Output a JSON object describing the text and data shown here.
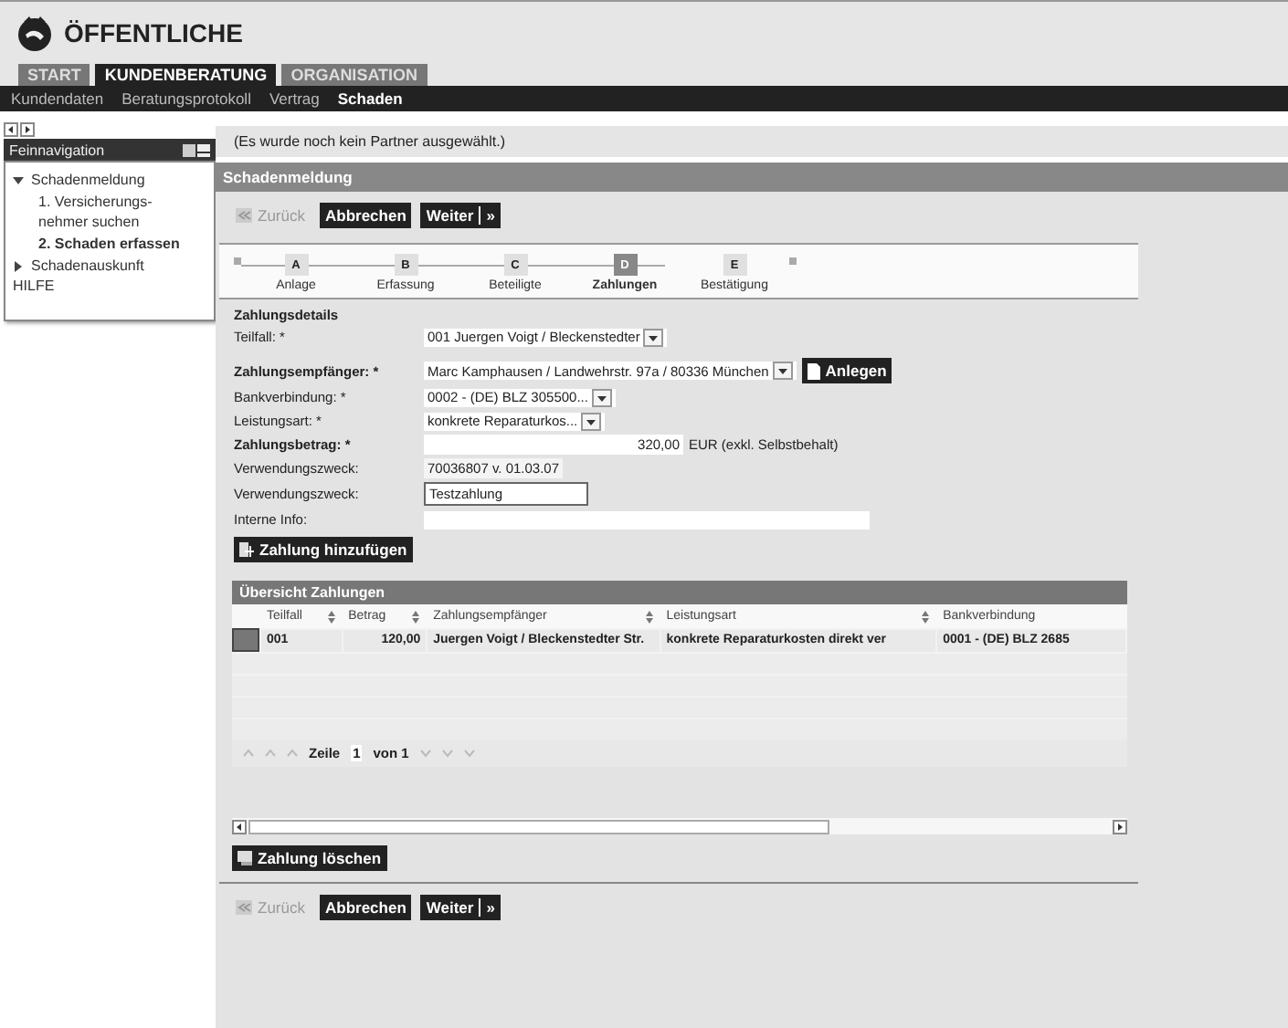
{
  "logo": {
    "name": "ÖFFENTLICHE"
  },
  "tabs": [
    {
      "label": "START",
      "selected": false
    },
    {
      "label": "KUNDENBERATUNG",
      "selected": true
    },
    {
      "label": "ORGANISATION",
      "selected": false
    }
  ],
  "subnav": [
    {
      "label": "Kundendaten",
      "selected": false
    },
    {
      "label": "Beratungsprotokoll",
      "selected": false
    },
    {
      "label": "Vertrag",
      "selected": false
    },
    {
      "label": "Schaden",
      "selected": true
    }
  ],
  "sidebar": {
    "title": "Feinnavigation",
    "items": [
      {
        "label": "Schadenmeldung",
        "kind": "group",
        "expanded": true,
        "children": [
          {
            "label": "1. Versicherungs-nehmer suchen",
            "selected": false
          },
          {
            "label": "2. Schaden erfassen",
            "selected": true
          }
        ]
      },
      {
        "label": "Schadenauskunft",
        "kind": "group",
        "expanded": false
      },
      {
        "label": "HILFE",
        "kind": "link"
      }
    ]
  },
  "message": "(Es wurde noch kein Partner ausgewählt.)",
  "panel_title": "Schadenmeldung",
  "top_buttons": [
    {
      "label": "Zurück",
      "kind": "back",
      "disabled": true
    },
    {
      "label": "Abbrechen",
      "kind": "plain",
      "disabled": false
    },
    {
      "label": "Weiter",
      "kind": "next",
      "disabled": false,
      "suffix": "»"
    }
  ],
  "steps": [
    {
      "letter": "A",
      "label": "Anlage",
      "selected": false
    },
    {
      "letter": "B",
      "label": "Erfassung",
      "selected": false
    },
    {
      "letter": "C",
      "label": "Beteiligte",
      "selected": false
    },
    {
      "letter": "D",
      "label": "Zahlungen",
      "selected": true
    },
    {
      "letter": "E",
      "label": "Bestätigung",
      "selected": false
    }
  ],
  "form": {
    "title": "Zahlungsdetails",
    "fields": [
      {
        "label": "Teilfall: *",
        "bold": false,
        "kind": "select",
        "value": "001 Juergen Voigt / Bleckenstedter"
      },
      {
        "label": "Zahlungsempfänger: *",
        "bold": true,
        "kind": "select",
        "value": "Marc Kamphausen / Landwehrstr. 97a / 80336 München",
        "action": "Anlegen"
      },
      {
        "label": "Bankverbindung: *",
        "bold": false,
        "kind": "select",
        "value": "0002 - (DE) BLZ 305500..."
      },
      {
        "label": "Leistungsart: *",
        "bold": false,
        "kind": "select",
        "value": "konkrete Reparaturkos..."
      },
      {
        "label": "Zahlungsbetrag: *",
        "bold": true,
        "kind": "amount",
        "value": "320,00",
        "unit": "EUR (exkl. Selbstbehalt)"
      },
      {
        "label": "Verwendungszweck:",
        "bold": false,
        "kind": "text",
        "value": "70036807 v. 01.03.07"
      },
      {
        "label": "Verwendungszweck:",
        "bold": false,
        "kind": "input",
        "value": "Testzahlung"
      },
      {
        "label": "Interne Info:",
        "bold": false,
        "kind": "wide"
      }
    ]
  },
  "add_button": "Zahlung hinzufügen",
  "table": {
    "title": "Übersicht Zahlungen",
    "columns": [
      {
        "label": "Teilfall",
        "sortable": true
      },
      {
        "label": "Betrag",
        "sortable": true
      },
      {
        "label": "Zahlungsempfänger",
        "sortable": true
      },
      {
        "label": "Leistungsart",
        "sortable": true
      },
      {
        "label": "Bankverbindung",
        "sortable": false
      }
    ],
    "rows": [
      {
        "selected": true,
        "cells": [
          "001",
          "120,00",
          "Juergen Voigt / Bleckenstedter Str.",
          "konkrete Reparaturkosten direkt ver",
          "0001 - (DE) BLZ 2685"
        ]
      }
    ]
  },
  "pagination": {
    "label": "Zeile",
    "page": "1",
    "total": "von 1"
  },
  "delete_button": "Zahlung löschen",
  "bottom_buttons": [
    {
      "label": "Zurück",
      "kind": "back",
      "disabled": true
    },
    {
      "label": "Abbrechen",
      "kind": "plain",
      "disabled": false
    },
    {
      "label": "Weiter",
      "kind": "next",
      "disabled": false,
      "suffix": "»"
    }
  ]
}
